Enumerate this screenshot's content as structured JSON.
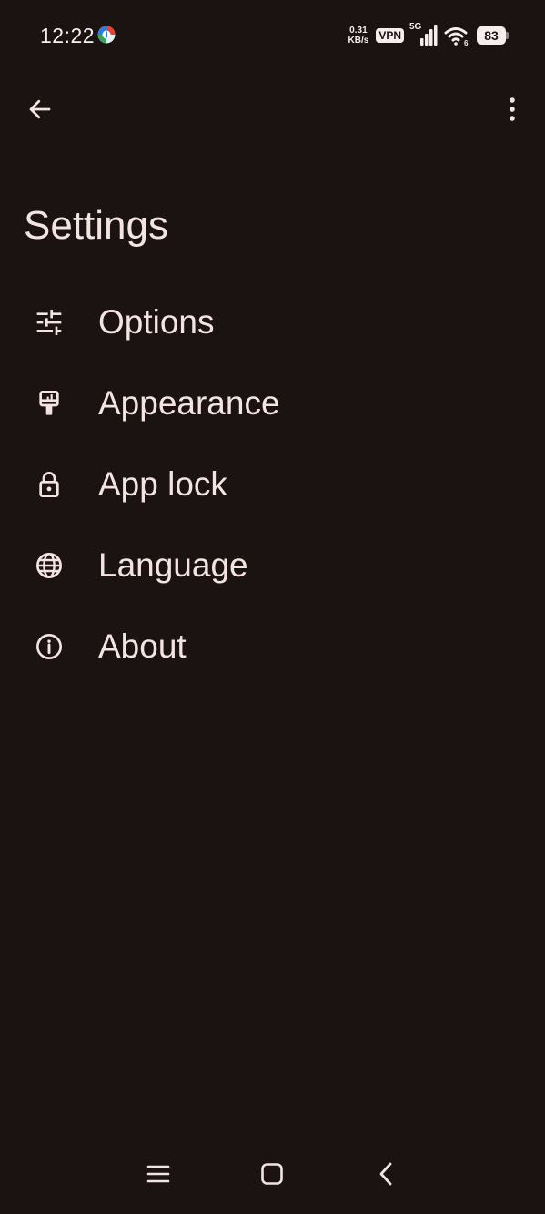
{
  "status_bar": {
    "time": "12:22",
    "net_speed_value": "0.31",
    "net_speed_unit": "KB/s",
    "vpn_label": "VPN",
    "network_type": "5G",
    "battery_level": "83"
  },
  "topbar": {
    "back_icon": "arrow-left-icon",
    "more_icon": "more-vert-icon"
  },
  "page": {
    "title": "Settings"
  },
  "settings": {
    "items": [
      {
        "label": "Options",
        "icon": "tune-icon"
      },
      {
        "label": "Appearance",
        "icon": "paint-brush-icon"
      },
      {
        "label": "App lock",
        "icon": "lock-icon"
      },
      {
        "label": "Language",
        "icon": "globe-icon"
      },
      {
        "label": "About",
        "icon": "info-icon"
      }
    ]
  },
  "nav_bar": {
    "recents_icon": "menu-icon",
    "home_icon": "home-square-icon",
    "back_icon": "chevron-left-icon"
  },
  "colors": {
    "background": "#1b1212",
    "text": "#f3e4e2"
  }
}
